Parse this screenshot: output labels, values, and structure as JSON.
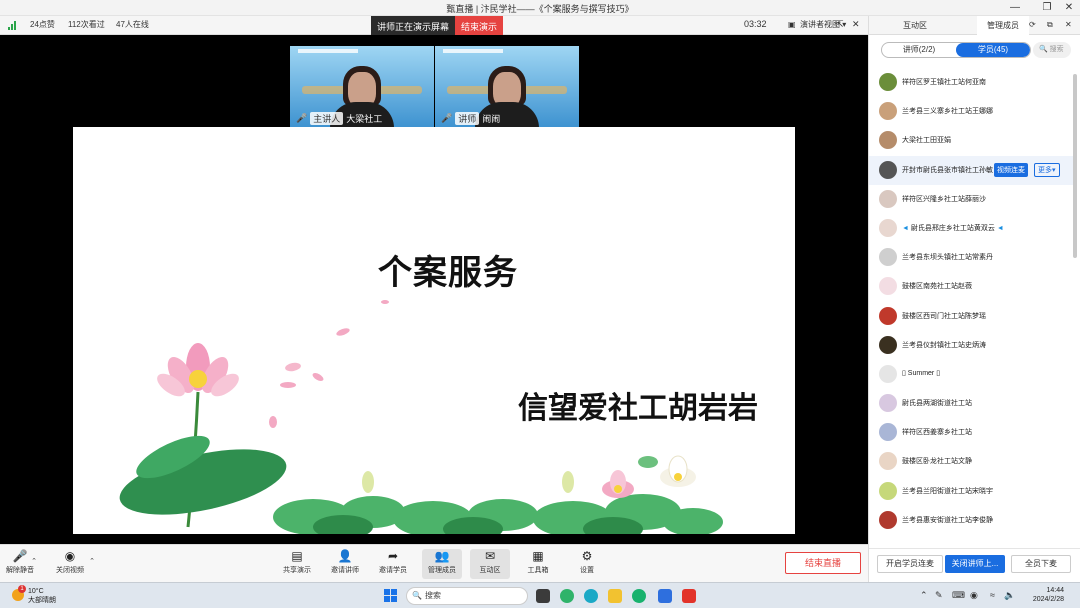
{
  "window": {
    "title": "甄直播 | 汴民学社——《个案服务与撰写技巧》"
  },
  "status": {
    "likes": "24点赞",
    "views": "112次看过",
    "online": "47人在线",
    "presenting_notice": "讲师正在演示屏幕",
    "end_demo": "结束演示",
    "timer": "03:32",
    "layout_label": "演讲者视图"
  },
  "videos": [
    {
      "role": "主讲人",
      "name": "大梁社工"
    },
    {
      "role": "讲师",
      "name": "闹闹"
    }
  ],
  "slide": {
    "title": "个案服务",
    "subtitle": "信望爱社工胡岩岩"
  },
  "toolbar": {
    "unmute": "解除静音",
    "video_off": "关闭视频",
    "share": "共享演示",
    "invite_lecturer": "邀请讲师",
    "invite_student": "邀请学员",
    "manage_members": "管理成员",
    "interaction": "互动区",
    "toolbox": "工具箱",
    "settings": "设置",
    "end_live": "结束直播"
  },
  "sidebar": {
    "tab_interaction": "互动区",
    "tab_members": "管理成员",
    "lecturers_tab": "讲师(2/2)",
    "students_tab": "学员(45)",
    "search_placeholder": "搜索",
    "video_link": "视频连麦",
    "more": "更多",
    "members": [
      "祥符区罗王镇社工站何亚南",
      "兰考县三义寨乡社工站王娜娜",
      "大梁社工田亚娟",
      "开封市尉氏县张市镇社工孙敏",
      "祥符区兴隆乡社工站薛丽沙",
      "尉氏县邢庄乡社工站黄双云",
      "兰考县东坝头镇社工站常素丹",
      "鼓楼区南苑社工站赵薇",
      "鼓楼区西司门社工站陈梦瑶",
      "兰考县仪封镇社工站史炳涛",
      "Summer",
      "尉氏县两湖街道社工站",
      "祥符区西姜寨乡社工站",
      "鼓楼区卧龙社工站文静",
      "兰考县兰阳街道社工站宋晓宇",
      "兰考县惠安街道社工站李俊静"
    ],
    "enable_mic": "开启学员连麦",
    "close_lecturer": "关闭讲师上...",
    "mute_all": "全员下麦"
  },
  "taskbar": {
    "temp": "10°C",
    "weather": "大部晴朗",
    "weather_badge": "1",
    "search": "搜索",
    "time": "14:44",
    "date": "2024/2/28"
  }
}
